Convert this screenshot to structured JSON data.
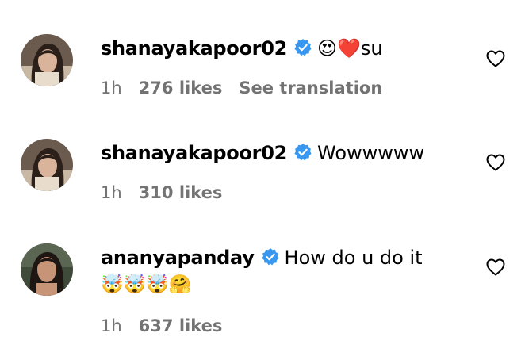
{
  "colors": {
    "verified_badge": "#3897f0",
    "meta_text": "#737373",
    "primary_text": "#000000",
    "background": "#ffffff"
  },
  "comments": [
    {
      "username": "shanayakapoor02",
      "text": "😍❤️su",
      "extra_line": "",
      "time": "1h",
      "likes": "276 likes",
      "translation_label": "See translation",
      "icons": [
        "avatar",
        "verified-badge-icon",
        "heart-outline-icon"
      ]
    },
    {
      "username": "shanayakapoor02",
      "text": "Wowwwww",
      "extra_line": "",
      "time": "1h",
      "likes": "310 likes",
      "icons": [
        "avatar",
        "verified-badge-icon",
        "heart-outline-icon"
      ]
    },
    {
      "username": "ananyapanday",
      "text": "How do u do it",
      "extra_line": "🤯🤯🤯🤗",
      "time": "1h",
      "likes": "637 likes",
      "icons": [
        "avatar",
        "verified-badge-icon",
        "heart-outline-icon"
      ]
    }
  ]
}
